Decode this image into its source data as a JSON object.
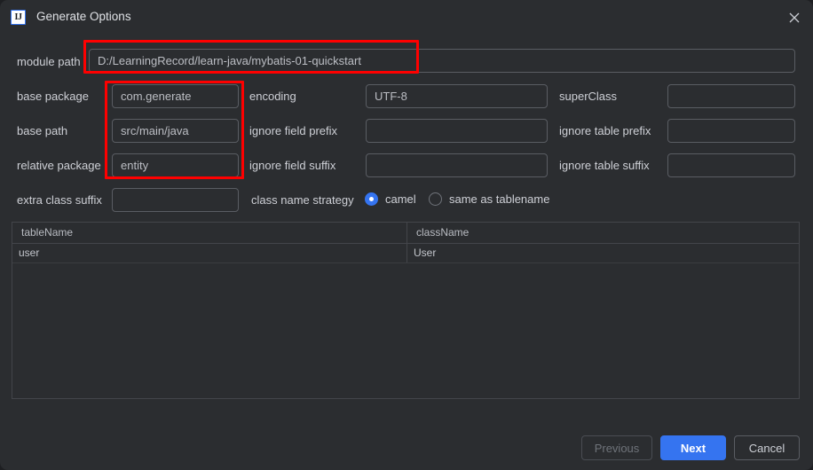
{
  "window": {
    "title": "Generate Options",
    "app_icon": "intellij-idea-icon",
    "icon_text": "IJ",
    "close_icon": "close-icon",
    "background_color": "#2b2d30",
    "accent_color": "#3574f0",
    "annotation_color": "#fe0000"
  },
  "form": {
    "module_path": {
      "label": "module path",
      "value": "D:/LearningRecord/learn-java/mybatis-01-quickstart"
    },
    "base_package": {
      "label": "base package",
      "value": "com.generate"
    },
    "base_path": {
      "label": "base path",
      "value": "src/main/java"
    },
    "relative_package": {
      "label": "relative package",
      "value": "entity"
    },
    "extra_class_suffix": {
      "label": "extra class suffix",
      "value": ""
    },
    "encoding": {
      "label": "encoding",
      "value": "UTF-8"
    },
    "ignore_field_prefix": {
      "label": "ignore field prefix",
      "value": ""
    },
    "ignore_field_suffix": {
      "label": "ignore field suffix",
      "value": ""
    },
    "super_class": {
      "label": "superClass",
      "value": ""
    },
    "ignore_table_prefix": {
      "label": "ignore table prefix",
      "value": ""
    },
    "ignore_table_suffix": {
      "label": "ignore table suffix",
      "value": ""
    },
    "class_name_strategy": {
      "label": "class name strategy",
      "selected": "camel",
      "options": [
        {
          "id": "camel",
          "label": "camel",
          "selected": true
        },
        {
          "id": "same-as-tablename",
          "label": "same as tablename",
          "selected": false
        }
      ]
    }
  },
  "table": {
    "columns": [
      "tableName",
      "className"
    ],
    "rows": [
      {
        "tableName": "user",
        "className": "User"
      }
    ]
  },
  "footer": {
    "previous": {
      "label": "Previous",
      "enabled": false
    },
    "next": {
      "label": "Next",
      "enabled": true,
      "primary": true
    },
    "cancel": {
      "label": "Cancel",
      "enabled": true
    }
  }
}
